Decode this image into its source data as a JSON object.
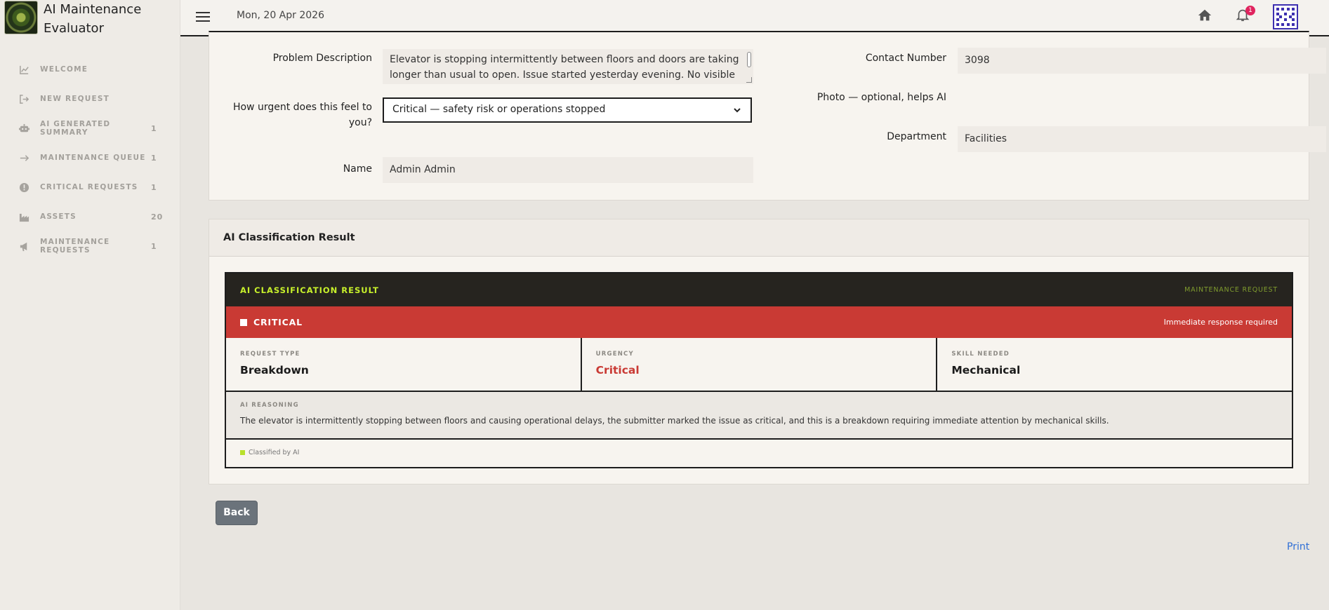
{
  "app": {
    "title": "AI Maintenance Evaluator"
  },
  "sidebar": {
    "items": [
      {
        "label": "WELCOME",
        "count": "",
        "icon": "chart-line-icon"
      },
      {
        "label": "NEW REQUEST",
        "count": "",
        "icon": "sign-in-icon"
      },
      {
        "label": "AI GENERATED SUMMARY",
        "count": "1",
        "icon": "robot-icon"
      },
      {
        "label": "MAINTENANCE QUEUE",
        "count": "1",
        "icon": "arrow-right-icon"
      },
      {
        "label": "CRITICAL REQUESTS",
        "count": "1",
        "icon": "exclamation-circle-icon"
      },
      {
        "label": "ASSETS",
        "count": "20",
        "icon": "industry-icon"
      },
      {
        "label": "MAINTENANCE REQUESTS",
        "count": "1",
        "icon": "bullhorn-icon"
      }
    ]
  },
  "topbar": {
    "date": "Mon, 20 Apr 2026",
    "notifications": "1"
  },
  "form": {
    "problem_description_label": "Problem Description",
    "problem_description_value": "Elevator is stopping intermittently between floors and doors are taking longer than usual to open. Issue started yesterday evening. No visible",
    "urgency_label": "How urgent does this feel to you?",
    "urgency_value": "Critical — safety risk or operations stopped",
    "name_label": "Name",
    "name_value": "Admin Admin",
    "contact_label": "Contact Number",
    "contact_value": "3098",
    "photo_label": "Photo — optional, helps AI",
    "department_label": "Department",
    "department_value": "Facilities"
  },
  "result_panel": {
    "title": "AI Classification Result",
    "header_title": "AI CLASSIFICATION RESULT",
    "header_sub": "MAINTENANCE REQUEST",
    "level": "CRITICAL",
    "level_note": "Immediate response required",
    "request_type_label": "REQUEST TYPE",
    "request_type_value": "Breakdown",
    "urgency_label": "URGENCY",
    "urgency_value": "Critical",
    "skill_label": "SKILL NEEDED",
    "skill_value": "Mechanical",
    "reasoning_label": "AI REASONING",
    "reasoning_text": "The elevator is intermittently stopping between floors and causing operational delays, the submitter marked the issue as critical, and this is a breakdown requiring immediate attention by mechanical skills.",
    "footer": "Classified by AI"
  },
  "actions": {
    "back_label": "Back",
    "print_label": "Print"
  },
  "colors": {
    "critical": "#c93a34",
    "accent_lime": "#c7f02b",
    "dark": "#26241f",
    "link": "#2f6fd6"
  }
}
